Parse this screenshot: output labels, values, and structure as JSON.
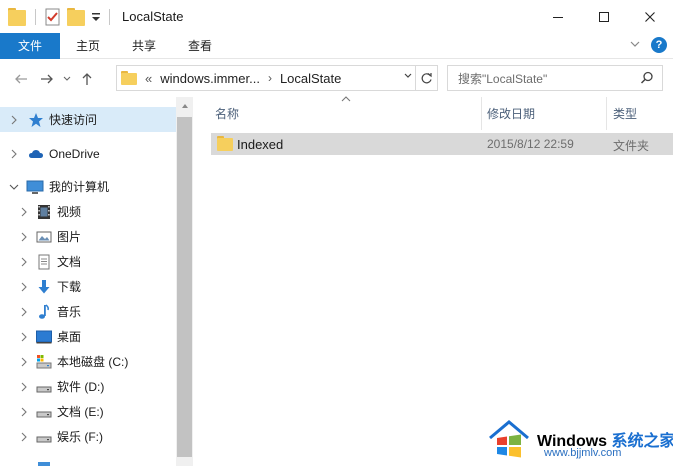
{
  "window": {
    "title": "LocalState",
    "minimize_glyph": "—",
    "maximize_glyph": "☐",
    "close_glyph": "✕"
  },
  "ribbon": {
    "tabs": [
      "文件",
      "主页",
      "共享",
      "查看"
    ],
    "expand_glyph": "⌄",
    "help_glyph": "?"
  },
  "address": {
    "back_glyph": "←",
    "forward_glyph": "→",
    "recent_glyph": "⌄",
    "up_glyph": "↑",
    "prefix": "«",
    "segments": [
      "windows.immer...",
      "LocalState"
    ],
    "chevron": "›",
    "dropdown_glyph": "⌄",
    "refresh_glyph": "↻"
  },
  "search": {
    "placeholder": "搜索\"LocalState\""
  },
  "nav": {
    "items": [
      {
        "label": "快速访问",
        "icon": "star-icon",
        "expanded": false,
        "selected": true
      },
      {
        "label": "OneDrive",
        "icon": "cloud-icon",
        "expanded": false
      },
      {
        "label": "我的计算机",
        "icon": "computer-icon",
        "expanded": true
      },
      {
        "label": "视频",
        "icon": "video-icon"
      },
      {
        "label": "图片",
        "icon": "pictures-icon"
      },
      {
        "label": "文档",
        "icon": "documents-icon"
      },
      {
        "label": "下载",
        "icon": "download-icon"
      },
      {
        "label": "音乐",
        "icon": "music-icon"
      },
      {
        "label": "桌面",
        "icon": "desktop-icon"
      },
      {
        "label": "本地磁盘 (C:)",
        "icon": "system-drive-icon"
      },
      {
        "label": "软件 (D:)",
        "icon": "drive-icon"
      },
      {
        "label": "文档 (E:)",
        "icon": "drive-icon"
      },
      {
        "label": "娱乐 (F:)",
        "icon": "drive-icon"
      }
    ],
    "chevron_collapsed": "›",
    "chevron_expanded": "⌄"
  },
  "columns": {
    "name": "名称",
    "date": "修改日期",
    "type": "类型",
    "sort_glyph": "^"
  },
  "files": [
    {
      "name": "Indexed",
      "modified": "2015/8/12 22:59",
      "type": "文件夹"
    }
  ],
  "watermark": {
    "brand": "Windows",
    "cn": "系统之家",
    "url": "www.bjjmlv.com"
  },
  "colors": {
    "accent": "#1979ca",
    "selected_nav": "#d9ebf9",
    "folder": "#f6cf5d",
    "row_selected": "#d9d9d9"
  }
}
